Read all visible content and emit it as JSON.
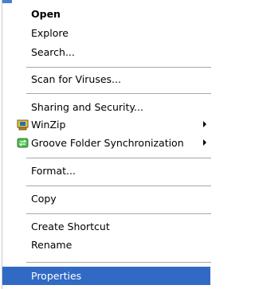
{
  "menu": {
    "items": [
      {
        "label": "Open"
      },
      {
        "label": "Explore"
      },
      {
        "label": "Search..."
      },
      {
        "label": "Scan for Viruses..."
      },
      {
        "label": "Sharing and Security..."
      },
      {
        "label": "WinZip",
        "icon": "winzip-icon"
      },
      {
        "label": "Groove Folder Synchronization",
        "icon": "groove-sync-icon"
      },
      {
        "label": "Format..."
      },
      {
        "label": "Copy"
      },
      {
        "label": "Create Shortcut"
      },
      {
        "label": "Rename"
      },
      {
        "label": "Properties"
      }
    ],
    "selected_index": 11
  }
}
